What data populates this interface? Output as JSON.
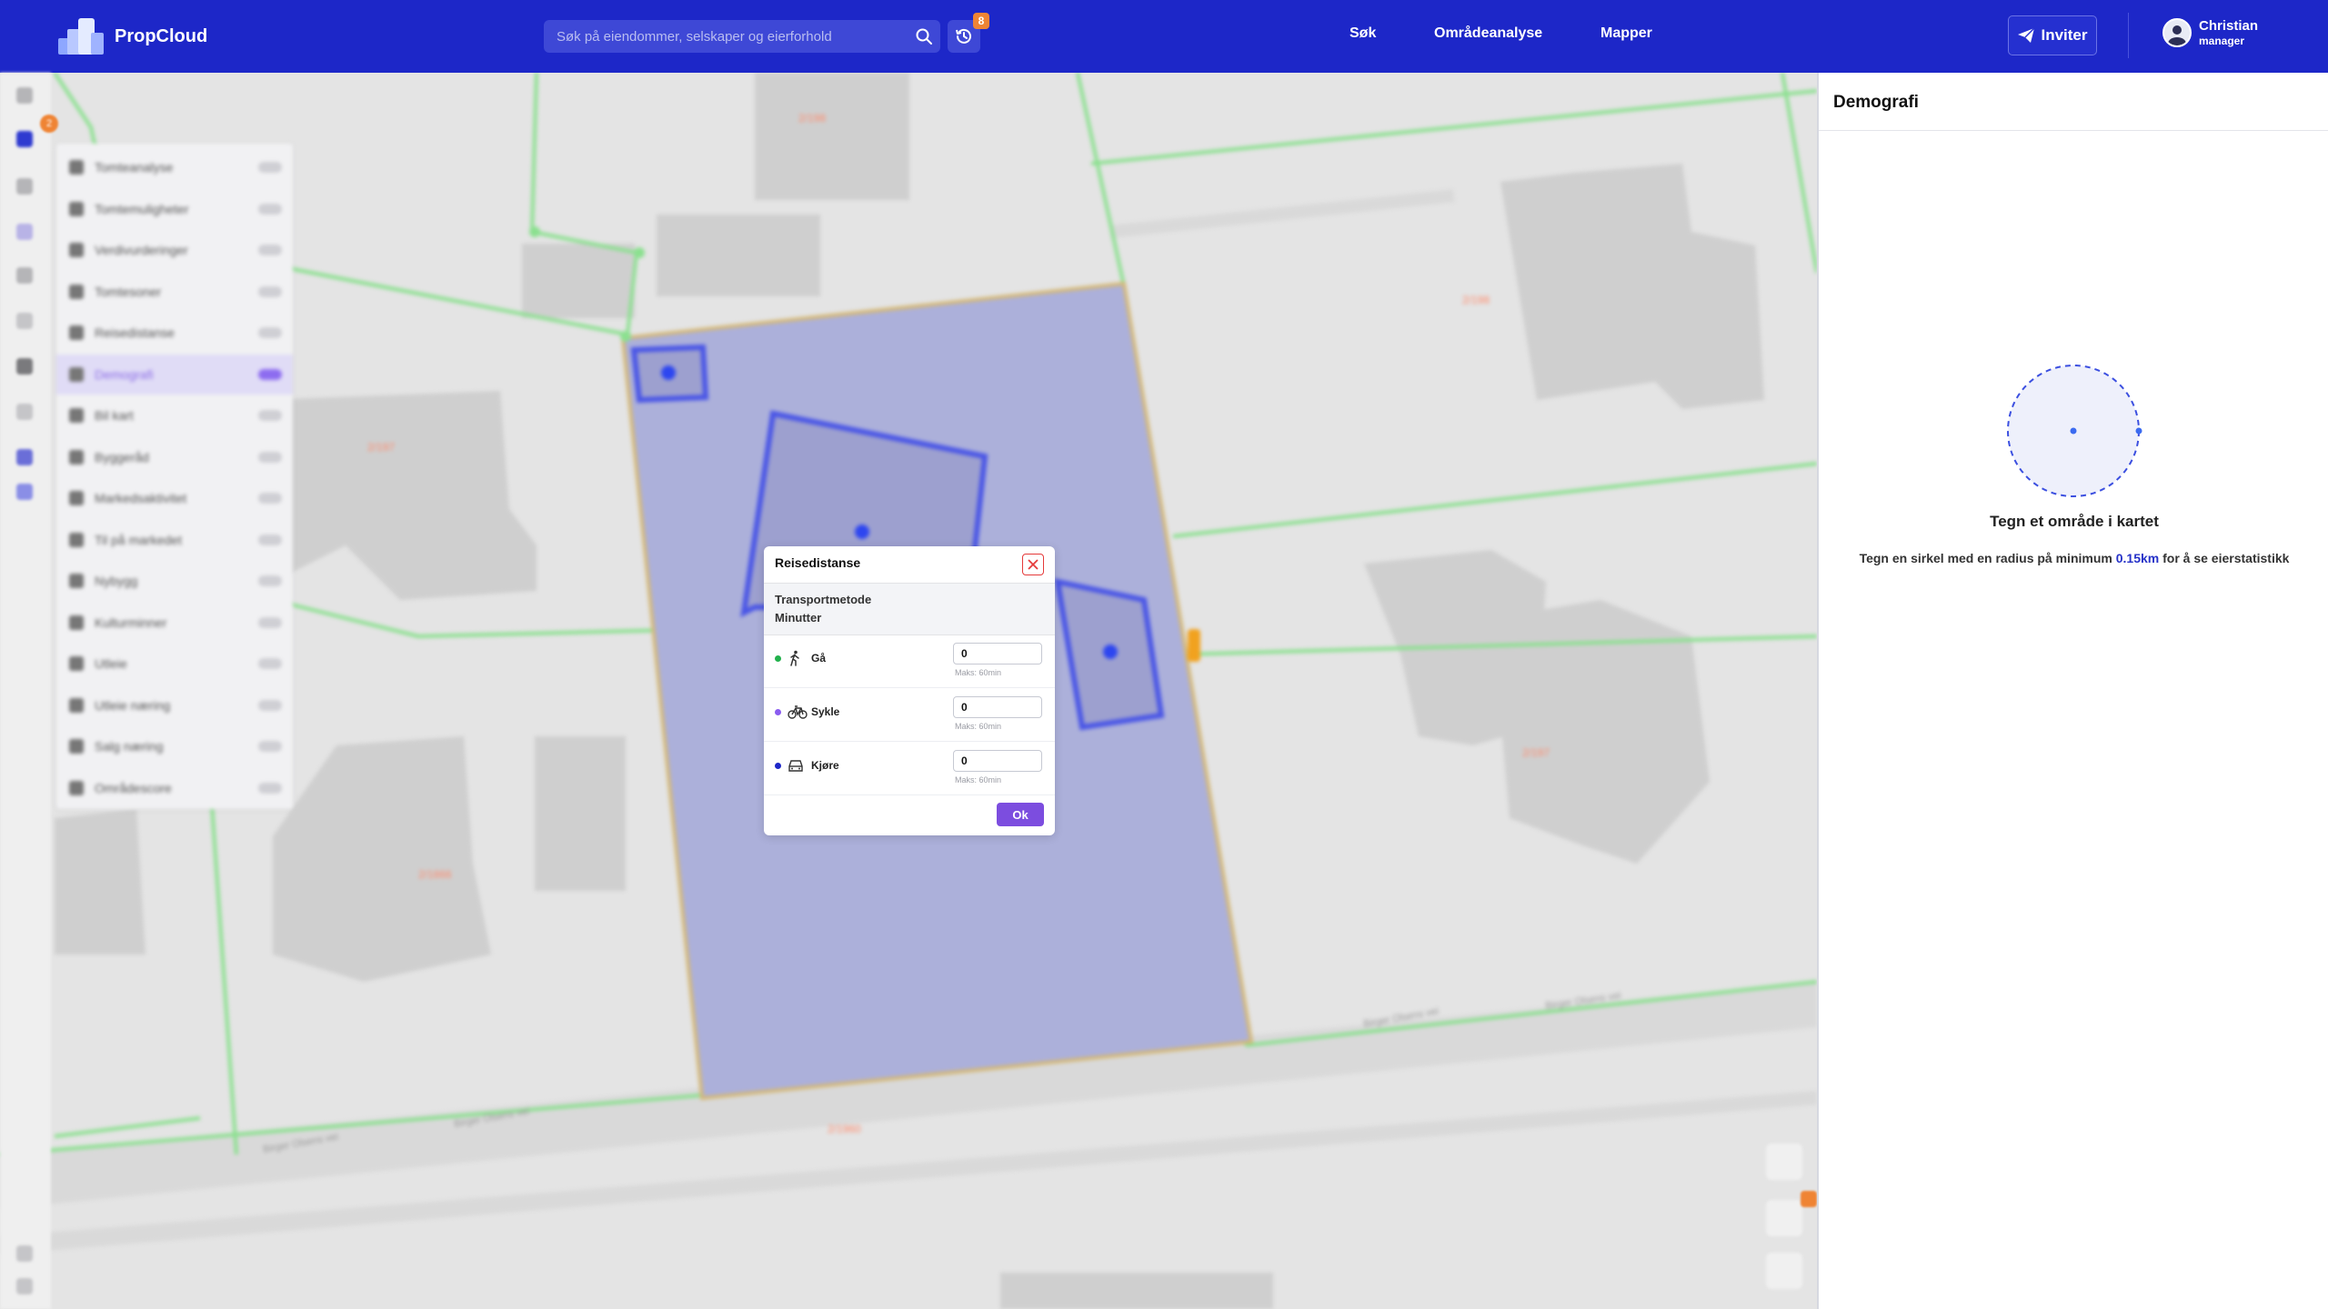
{
  "header": {
    "brand": "PropCloud",
    "search_placeholder": "Søk på eiendommer, selskaper og eierforhold",
    "history_badge": "8",
    "nav": [
      "Søk",
      "Områdeanalyse",
      "Mapper"
    ],
    "invite_label": "Inviter",
    "user_name": "Christian",
    "user_role": "manager",
    "colors": {
      "bar": "#1d27c8",
      "badge": "#ef8434"
    }
  },
  "map": {
    "layer_badge": "2",
    "layers": [
      {
        "label": "Tomteanalyse",
        "active": false
      },
      {
        "label": "Tomtemuligheter",
        "active": false
      },
      {
        "label": "Verdivurderinger",
        "active": false
      },
      {
        "label": "Tomtesoner",
        "active": false
      },
      {
        "label": "Reisedistanse",
        "active": false
      },
      {
        "label": "Demografi",
        "active": true
      },
      {
        "label": "Bil kart",
        "active": false
      },
      {
        "label": "Byggeråd",
        "active": false
      },
      {
        "label": "Markedsaktivitet",
        "active": false
      },
      {
        "label": "Til på markedet",
        "active": false
      },
      {
        "label": "Nybygg",
        "active": false
      },
      {
        "label": "Kulturminner",
        "active": false
      },
      {
        "label": "Utleie",
        "active": false
      },
      {
        "label": "Utleie næring",
        "active": false
      },
      {
        "label": "Salg næring",
        "active": false
      },
      {
        "label": "Områdescore",
        "active": false
      }
    ]
  },
  "modal": {
    "title": "Reisedistanse",
    "subheader_line1": "Transportmetode",
    "subheader_line2": "Minutter",
    "rows": [
      {
        "label": "Gå",
        "value": "0",
        "hint": "Maks: 60min",
        "dot_color": "#22b14c",
        "icon": "walk-icon"
      },
      {
        "label": "Sykle",
        "value": "0",
        "hint": "Maks: 60min",
        "dot_color": "#8a5cf0",
        "icon": "bike-icon"
      },
      {
        "label": "Kjøre",
        "value": "0",
        "hint": "Maks: 60min",
        "dot_color": "#1d27c8",
        "icon": "car-icon"
      }
    ],
    "ok_label": "Ok"
  },
  "side_panel": {
    "title": "Demografi",
    "heading": "Tegn et område i kartet",
    "text_before": "Tegn en sirkel med en radius på minimum",
    "text_highlight": "0.15km",
    "text_after": "for å se eierstatistikk"
  }
}
